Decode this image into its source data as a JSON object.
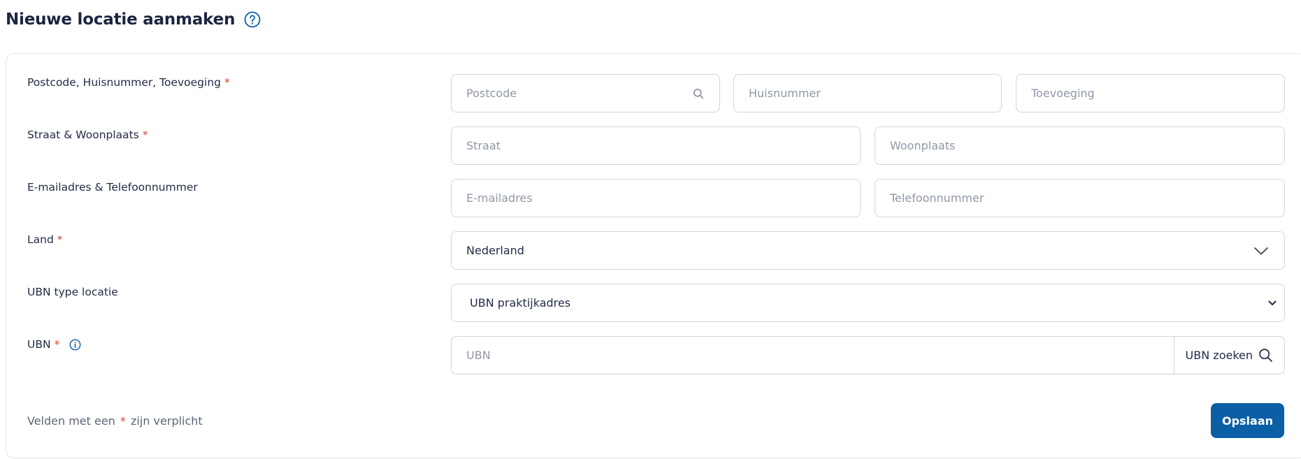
{
  "page": {
    "title": "Nieuwe locatie aanmaken"
  },
  "form": {
    "address_label": "Postcode, Huisnummer, Toevoeging",
    "postcode_placeholder": "Postcode",
    "huisnummer_placeholder": "Huisnummer",
    "toevoeging_placeholder": "Toevoeging",
    "street_label": "Straat & Woonplaats",
    "straat_placeholder": "Straat",
    "woonplaats_placeholder": "Woonplaats",
    "contact_label": "E-mailadres & Telefoonnummer",
    "email_placeholder": "E-mailadres",
    "phone_placeholder": "Telefoonnummer",
    "land_label": "Land",
    "land_value": "Nederland",
    "ubn_type_label": "UBN type locatie",
    "ubn_type_value": "UBN praktijkadres",
    "ubn_label": "UBN",
    "ubn_placeholder": "UBN",
    "ubn_search_label": "UBN zoeken",
    "required_mark": "*"
  },
  "footer": {
    "note_prefix": "Velden met een",
    "note_suffix": "zijn verplicht",
    "save_label": "Opslaan"
  },
  "colors": {
    "primary": "#0b5fa5",
    "required": "#e53935",
    "border": "#cfd5de",
    "placeholder": "#8f97a6"
  },
  "icons": {
    "help": "question-circle-icon",
    "postcode_search": "search-icon",
    "land_dropdown": "chevron-down-icon",
    "ubn_type_dropdown": "chevron-down-icon",
    "ubn_info": "info-icon",
    "ubn_search": "search-icon"
  }
}
